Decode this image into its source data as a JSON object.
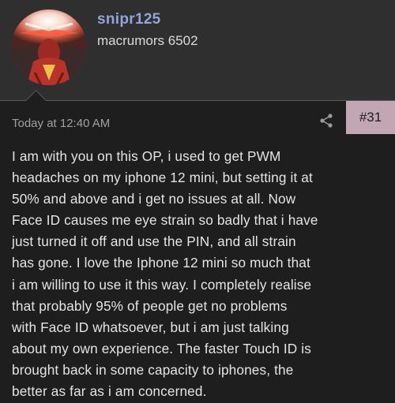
{
  "user": {
    "username": "snipr125",
    "title": "macrumors 6502"
  },
  "post": {
    "timestamp": "Today at 12:40 AM",
    "number": "#31",
    "body_lines": [
      "I am with you on this OP, i used to get PWM",
      "headaches on my iphone 12 mini, but setting it at",
      "50% and above and i get no issues at all. Now",
      "Face ID causes me eye strain so badly that i have",
      "just turned it off and use the PIN, and all strain",
      "has gone. I love the Iphone 12 mini so much that",
      "i am willing to use it this way. I completely realise",
      "that probably 95% of people get no problems",
      "with Face ID whatsoever, but i am just talking",
      "about my own experience. The faster Touch ID is",
      "brought back in some capacity to iphones, the",
      "better as far as i am concerned."
    ]
  },
  "colors": {
    "header_bg": "#2f2f30",
    "post_bg": "#1e1e1e",
    "username": "#8fa6d8",
    "post_number_bg": "#c2a6b3"
  },
  "icons": {
    "share": "share-icon",
    "avatar": "avatar"
  }
}
